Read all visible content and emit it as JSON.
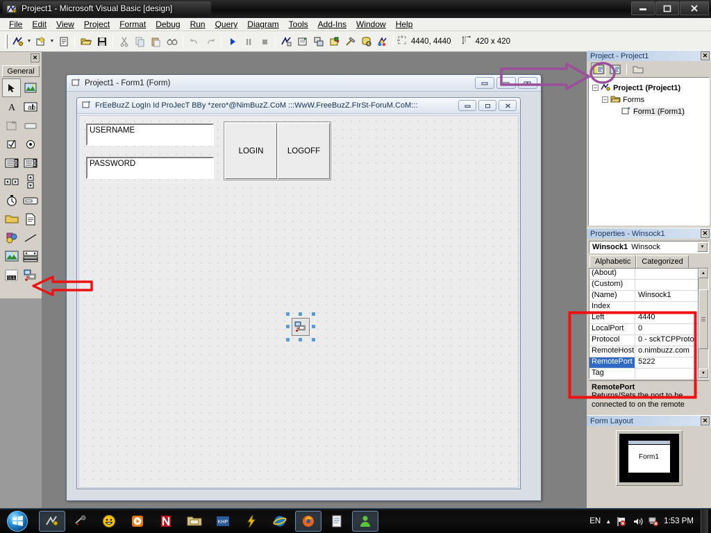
{
  "window": {
    "title": "Project1 - Microsoft Visual Basic [design]",
    "icon": "vb-app-icon",
    "minimize_label": "–",
    "maximize_label": "❐",
    "close_label": "✕"
  },
  "menubar": {
    "items": [
      {
        "label": "File"
      },
      {
        "label": "Edit"
      },
      {
        "label": "View"
      },
      {
        "label": "Project"
      },
      {
        "label": "Format"
      },
      {
        "label": "Debug"
      },
      {
        "label": "Run"
      },
      {
        "label": "Query"
      },
      {
        "label": "Diagram"
      },
      {
        "label": "Tools"
      },
      {
        "label": "Add-Ins"
      },
      {
        "label": "Window"
      },
      {
        "label": "Help"
      }
    ]
  },
  "toolbar": {
    "buttons": [
      {
        "name": "add-project-button",
        "icon": "vb-project-icon"
      },
      {
        "name": "add-form-button",
        "icon": "add-form-icon"
      },
      {
        "name": "menu-editor-button",
        "icon": "menu-editor-icon"
      },
      {
        "name": "open-project-button",
        "icon": "open-folder-icon"
      },
      {
        "name": "save-project-button",
        "icon": "floppy-disk-icon"
      },
      {
        "name": "cut-button",
        "icon": "scissors-icon"
      },
      {
        "name": "copy-button",
        "icon": "copy-icon"
      },
      {
        "name": "paste-button",
        "icon": "paste-icon"
      },
      {
        "name": "find-button",
        "icon": "binoculars-icon"
      },
      {
        "name": "undo-button",
        "icon": "undo-arrow-icon"
      },
      {
        "name": "redo-button",
        "icon": "redo-arrow-icon"
      },
      {
        "name": "start-button",
        "icon": "play-triangle-icon"
      },
      {
        "name": "break-button",
        "icon": "pause-icon"
      },
      {
        "name": "end-button",
        "icon": "stop-square-icon"
      },
      {
        "name": "project-explorer-button",
        "icon": "project-explorer-icon"
      },
      {
        "name": "properties-window-button",
        "icon": "properties-window-icon"
      },
      {
        "name": "form-layout-button",
        "icon": "form-layout-icon"
      },
      {
        "name": "object-browser-button",
        "icon": "object-browser-icon"
      },
      {
        "name": "toolbox-button",
        "icon": "toolbox-hammer-icon"
      },
      {
        "name": "data-view-button",
        "icon": "data-view-icon"
      },
      {
        "name": "visual-component-manager-button",
        "icon": "component-manager-icon"
      }
    ],
    "position_icon": "position-crosshair-icon",
    "position_value": "4440, 4440",
    "size_icon": "size-arrows-icon",
    "size_value": "420 x 420"
  },
  "toolbox": {
    "title_close": "✕",
    "tab_label": "General",
    "items": [
      {
        "name": "pointer-tool",
        "icon": "arrow-pointer-icon",
        "selected": true
      },
      {
        "name": "picturebox-tool",
        "icon": "picture-box-icon"
      },
      {
        "name": "label-tool",
        "icon": "label-A-icon"
      },
      {
        "name": "textbox-tool",
        "icon": "textbox-abl-icon"
      },
      {
        "name": "frame-tool",
        "icon": "frame-xy-icon"
      },
      {
        "name": "commandbutton-tool",
        "icon": "command-button-icon"
      },
      {
        "name": "checkbox-tool",
        "icon": "checkbox-icon"
      },
      {
        "name": "optionbutton-tool",
        "icon": "option-radio-icon"
      },
      {
        "name": "combobox-tool",
        "icon": "combo-box-icon"
      },
      {
        "name": "listbox-tool",
        "icon": "list-box-icon"
      },
      {
        "name": "hscrollbar-tool",
        "icon": "hscrollbar-icon"
      },
      {
        "name": "vscrollbar-tool",
        "icon": "vscrollbar-icon"
      },
      {
        "name": "timer-tool",
        "icon": "timer-stopwatch-icon"
      },
      {
        "name": "drivelistbox-tool",
        "icon": "drive-list-icon"
      },
      {
        "name": "dirlistbox-tool",
        "icon": "folder-dir-icon"
      },
      {
        "name": "filelistbox-tool",
        "icon": "file-list-icon"
      },
      {
        "name": "shape-tool",
        "icon": "shape-icon"
      },
      {
        "name": "line-tool",
        "icon": "line-icon"
      },
      {
        "name": "image-tool",
        "icon": "image-icon"
      },
      {
        "name": "data-tool",
        "icon": "data-control-icon"
      },
      {
        "name": "ole-tool",
        "icon": "ole-icon"
      },
      {
        "name": "winsock-tool",
        "icon": "winsock-icon"
      }
    ]
  },
  "designer": {
    "title": "Project1 - Form1 (Form)",
    "icon": "form-icon",
    "minimize_label": "–",
    "restore_label": "❒",
    "close_label": "✖",
    "form": {
      "title": "FrEeBuzZ LogIn Id ProJecT BBy *zero*@NimBuzZ.CoM :::WwW.FreeBuzZ.FIrSt-ForuM.CoM:::",
      "icon": "form-icon",
      "minimize_label": "–",
      "maximize_label": "□",
      "close_label": "✕",
      "controls": [
        {
          "name": "username-textbox",
          "type": "textbox",
          "text": "USERNAME"
        },
        {
          "name": "password-textbox",
          "type": "textbox",
          "text": "PASSWORD"
        },
        {
          "name": "login-button",
          "type": "button",
          "text": "LOGIN"
        },
        {
          "name": "logoff-button",
          "type": "button",
          "text": "LOGOFF"
        },
        {
          "name": "winsock-control",
          "type": "winsock",
          "icon": "winsock-icon",
          "selected": true
        }
      ]
    }
  },
  "project_explorer": {
    "title": "Project - Project1",
    "close_label": "✕",
    "toolbar": [
      {
        "name": "view-code-button",
        "icon": "view-code-icon",
        "active": true
      },
      {
        "name": "view-object-button",
        "icon": "view-object-icon"
      },
      {
        "name": "toggle-folders-button",
        "icon": "folder-toggle-icon"
      }
    ],
    "tree": [
      {
        "label": "Project1 (Project1)",
        "icon": "vb-project-icon",
        "expander": "–",
        "depth": 0,
        "bold": true
      },
      {
        "label": "Forms",
        "icon": "folder-icon",
        "expander": "–",
        "depth": 1,
        "bold": false
      },
      {
        "label": "Form1 (Form1)",
        "icon": "form-icon",
        "expander": "",
        "depth": 2,
        "bold": false,
        "highlight": true
      }
    ]
  },
  "properties": {
    "title": "Properties - Winsock1",
    "close_label": "✕",
    "object_name": "Winsock1",
    "object_type": "Winsock",
    "dropdown_arrow": "▼",
    "tabs": [
      {
        "label": "Alphabetic",
        "active": true
      },
      {
        "label": "Categorized",
        "active": false
      }
    ],
    "rows": [
      {
        "name": "(About)",
        "value": "",
        "selected": false
      },
      {
        "name": "(Custom)",
        "value": "",
        "selected": false
      },
      {
        "name": "(Name)",
        "value": "Winsock1",
        "selected": false
      },
      {
        "name": "Index",
        "value": "",
        "selected": false
      },
      {
        "name": "Left",
        "value": "4440",
        "selected": false
      },
      {
        "name": "LocalPort",
        "value": "0",
        "selected": false
      },
      {
        "name": "Protocol",
        "value": "0 - sckTCPProto",
        "selected": false
      },
      {
        "name": "RemoteHost",
        "value": "o.nimbuzz.com",
        "selected": false
      },
      {
        "name": "RemotePort",
        "value": "5222",
        "selected": true
      },
      {
        "name": "Tag",
        "value": "",
        "selected": false
      }
    ],
    "scroll_up": "▲",
    "scroll_down": "▼",
    "description_title": "RemotePort",
    "description_text": "Returns/Sets the port to be connected to on the remote"
  },
  "form_layout": {
    "title": "Form Layout",
    "close_label": "✕",
    "form_label": "Form1"
  },
  "taskbar": {
    "start_icon": "windows-start-orb",
    "tasks": [
      {
        "name": "task-visual-basic",
        "icon": "vb-app-icon",
        "active": true
      },
      {
        "name": "task-media-tool",
        "icon": "dark-tool-icon",
        "active": false
      },
      {
        "name": "task-smiley",
        "icon": "smiley-icon",
        "active": false
      },
      {
        "name": "task-media-player",
        "icon": "orange-play-icon",
        "active": false
      },
      {
        "name": "task-netflix",
        "icon": "red-n-icon",
        "active": false
      },
      {
        "name": "task-explorer",
        "icon": "folder-explorer-icon",
        "active": false
      },
      {
        "name": "task-khp",
        "icon": "khp-icon",
        "active": false
      },
      {
        "name": "task-lightning",
        "icon": "lightning-icon",
        "active": false
      },
      {
        "name": "task-internet-explorer",
        "icon": "ie-globe-icon",
        "active": false
      },
      {
        "name": "task-firefox",
        "icon": "firefox-icon",
        "active": true
      },
      {
        "name": "task-notepad",
        "icon": "notepad-icon",
        "active": false
      },
      {
        "name": "task-green-person",
        "icon": "green-person-icon",
        "active": true
      }
    ],
    "tray": {
      "language": "EN",
      "show_hidden": "▲",
      "icons": [
        {
          "name": "flag-action-center-icon"
        },
        {
          "name": "volume-speaker-icon"
        },
        {
          "name": "network-icon"
        }
      ],
      "clock": "1:53 PM"
    }
  },
  "annotations": [
    {
      "name": "red-arrow-toolbox",
      "color": "#ee1111",
      "points_to": "winsock-tool"
    },
    {
      "name": "purple-arrow-project-explorer",
      "color": "#9b4f9b",
      "points_to": "view-code-button"
    },
    {
      "name": "purple-circle-view-code",
      "color": "#9b4f9b",
      "points_to": "view-code-button"
    },
    {
      "name": "red-box-properties",
      "color": "#ee1111",
      "points_to": "properties-grid"
    }
  ]
}
